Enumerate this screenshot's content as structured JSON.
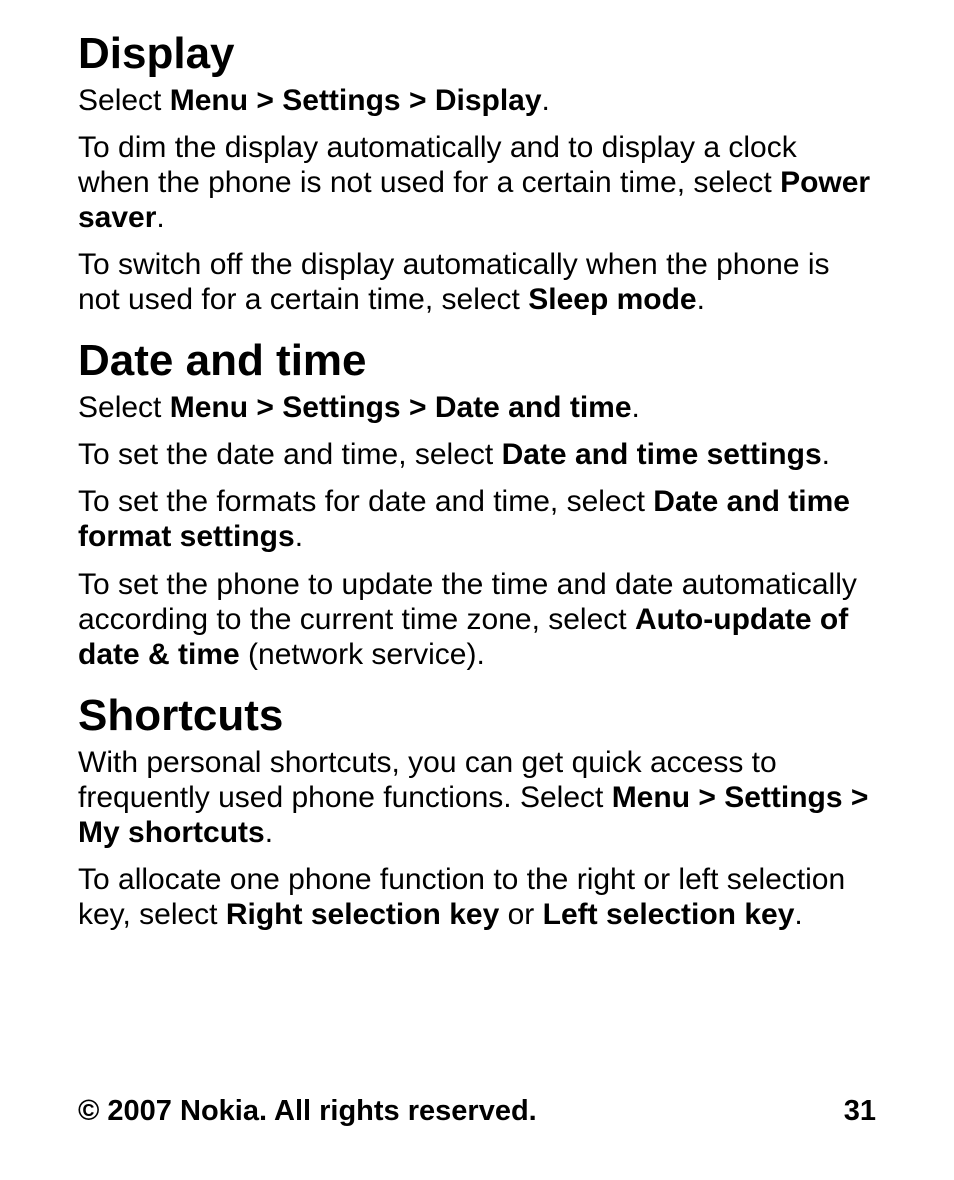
{
  "display": {
    "heading": "Display",
    "nav_pre": "Select ",
    "nav_b1": "Menu",
    "nav_sep": " > ",
    "nav_b2": "Settings",
    "nav_b3": "Display",
    "nav_post": ".",
    "p1_a": "To dim the display automatically and to display a clock when the phone is not used for a certain time, select ",
    "p1_b": "Power saver",
    "p1_c": ".",
    "p2_a": "To switch off the display automatically when the phone is not used for a certain time, select ",
    "p2_b": "Sleep mode",
    "p2_c": "."
  },
  "datetime": {
    "heading": "Date and time",
    "nav_pre": "Select ",
    "nav_b1": "Menu",
    "nav_sep": " > ",
    "nav_b2": "Settings",
    "nav_b3": "Date and time",
    "nav_post": ".",
    "p1_a": "To set the date and time, select ",
    "p1_b": "Date and time settings",
    "p1_c": ".",
    "p2_a": "To set the formats for date and time, select ",
    "p2_b": "Date and time format settings",
    "p2_c": ".",
    "p3_a": "To set the phone to update the time and date automatically according to the current time zone, select ",
    "p3_b": "Auto-update of date & time",
    "p3_c": " (network service)."
  },
  "shortcuts": {
    "heading": "Shortcuts",
    "p1_a": "With personal shortcuts, you can get quick access to frequently used phone functions. Select ",
    "p1_b1": "Menu",
    "p1_sep": " > ",
    "p1_b2": "Settings",
    "p1_b3": "My shortcuts",
    "p1_c": ".",
    "p2_a": "To allocate one phone function to the right or left selection key, select ",
    "p2_b1": "Right selection key",
    "p2_mid": " or ",
    "p2_b2": "Left selection key",
    "p2_c": "."
  },
  "footer": {
    "copyright": "© 2007 Nokia. All rights reserved.",
    "page": "31"
  }
}
